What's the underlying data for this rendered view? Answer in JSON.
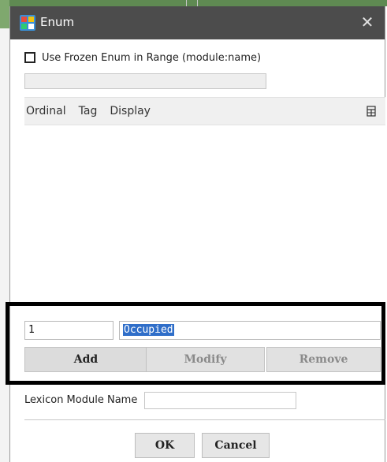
{
  "dialog": {
    "title": "Enum",
    "close_glyph": "✕",
    "icon": "enum-app-icon"
  },
  "frozen_enum": {
    "label": "Use Frozen Enum in Range (module:name)",
    "checked": false,
    "range_value": ""
  },
  "table": {
    "columns": [
      "Ordinal",
      "Tag",
      "Display"
    ],
    "rows": [],
    "column_menu_icon": "column-chooser-icon"
  },
  "editor": {
    "ordinal_value": "1",
    "tag_value": "Occupied",
    "add_label": "Add",
    "modify_label": "Modify",
    "remove_label": "Remove"
  },
  "lexicon": {
    "label": "Lexicon Module Name",
    "value": ""
  },
  "footer": {
    "ok_label": "OK",
    "cancel_label": "Cancel"
  },
  "colors": {
    "titlebar": "#4c4c4c",
    "selection": "#2f6ec9",
    "highlight_frame": "#000000"
  }
}
